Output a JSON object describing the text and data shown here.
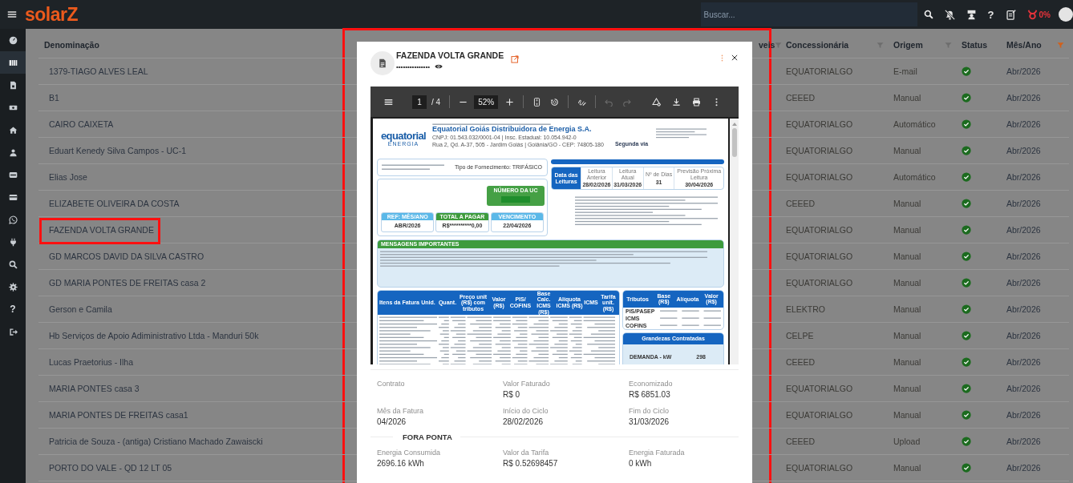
{
  "topbar": {
    "logo": "solarZ",
    "search": {
      "placeholder": "Buscar..."
    },
    "help": "?",
    "alert_level": "0%"
  },
  "sidebar": {
    "items": [
      {
        "selected": false
      },
      {
        "selected": true
      },
      {
        "selected": false
      },
      {
        "selected": false
      },
      {
        "selected": false
      },
      {
        "selected": false
      },
      {
        "selected": false
      },
      {
        "selected": false
      },
      {
        "selected": false
      },
      {
        "selected": false
      },
      {
        "selected": false
      },
      {
        "selected": false
      },
      {
        "selected": false,
        "glyph": "?"
      },
      {
        "selected": false
      }
    ]
  },
  "table": {
    "columns": [
      {
        "label": "Denominação",
        "filter": false
      },
      {
        "label": "veis",
        "filter": true,
        "filter_active": false
      },
      {
        "label": "Concessionária",
        "filter": true,
        "filter_active": false
      },
      {
        "label": "Origem",
        "filter": true,
        "filter_active": false
      },
      {
        "label": "Status",
        "filter": false
      },
      {
        "label": "Mês/Ano",
        "filter": true,
        "filter_active": true
      }
    ],
    "rows": [
      {
        "name": "1379-TIAGO ALVES LEAL",
        "utility": "EQUATORIALGO",
        "origin": "E-mail",
        "ok": true,
        "month": "Abr/2026",
        "marked": false
      },
      {
        "name": "B1",
        "utility": "CEEED",
        "origin": "Manual",
        "ok": true,
        "month": "Abr/2026",
        "marked": false
      },
      {
        "name": "CAIRO CAIXETA",
        "utility": "EQUATORIALGO",
        "origin": "Automático",
        "ok": true,
        "month": "Abr/2026",
        "marked": false
      },
      {
        "name": "Eduart Kenedy Silva Campos - UC-1",
        "utility": "EQUATORIALGO",
        "origin": "Manual",
        "ok": true,
        "month": "Abr/2026",
        "marked": false
      },
      {
        "name": "Elias Jose",
        "utility": "EQUATORIALGO",
        "origin": "Automático",
        "ok": true,
        "month": "Abr/2026",
        "marked": false
      },
      {
        "name": "ELIZABETE OLIVEIRA DA COSTA",
        "utility": "CEEED",
        "origin": "Manual",
        "ok": true,
        "month": "Abr/2026",
        "marked": false
      },
      {
        "name": "FAZENDA VOLTA GRANDE",
        "utility": "EQUATORIALGO",
        "origin": "Manual",
        "ok": true,
        "month": "Abr/2026",
        "marked": true
      },
      {
        "name": "GD MARCOS DAVID DA SILVA CASTRO",
        "utility": "EQUATORIALGO",
        "origin": "Manual",
        "ok": true,
        "month": "Abr/2026",
        "marked": false
      },
      {
        "name": "GD MARIA PONTES DE FREITAS casa 2",
        "utility": "EQUATORIALGO",
        "origin": "Manual",
        "ok": true,
        "month": "Abr/2026",
        "marked": false
      },
      {
        "name": "Gerson e Camila",
        "utility": "ELEKTRO",
        "origin": "Manual",
        "ok": true,
        "month": "Abr/2026",
        "marked": false
      },
      {
        "name": "Hb Serviços de Apoio Adiministrativo Ltda - Manduri 50k",
        "utility": "CELPE",
        "origin": "Manual",
        "ok": true,
        "month": "Abr/2026",
        "marked": false
      },
      {
        "name": "Lucas Praetorius - Ilha",
        "utility": "CEEED",
        "origin": "Manual",
        "ok": true,
        "month": "Abr/2026",
        "marked": false
      },
      {
        "name": "MARIA PONTES casa 3",
        "utility": "EQUATORIALGO",
        "origin": "Manual",
        "ok": true,
        "month": "Abr/2026",
        "marked": false
      },
      {
        "name": "MARIA PONTES DE FREITAS casa1",
        "utility": "EQUATORIALGO",
        "origin": "Manual",
        "ok": true,
        "month": "Abr/2026",
        "marked": false
      },
      {
        "name": "Patricia de Souza - (antiga) Cristiano Machado Zawaiscki",
        "utility": "CEEED",
        "origin": "Upload",
        "ok": true,
        "month": "Abr/2026",
        "marked": false
      },
      {
        "name": "PORTO DO VALE - QD 12 LT 05",
        "utility": "EQUATORIALGO",
        "origin": "Manual",
        "ok": true,
        "month": "Abr/2026",
        "marked": false
      }
    ]
  },
  "modal": {
    "title": "FAZENDA VOLTA GRANDE",
    "masked_id": "•••••••••••••••",
    "marked": true,
    "viewer": {
      "page": "1",
      "page_count": "/ 4",
      "zoom": "52%",
      "undo_enabled": false,
      "redo_enabled": false,
      "document": {
        "logo": "equatorial",
        "logo_sub": "ENERGIA",
        "company": "Equatorial Goiás Distribuidora de Energia S.A.",
        "cnpj": "CNPJ: 01.543.032/0001-04 | Insc. Estadual: 10.054.942-0",
        "address": "Rua 2, Qd. A-37, 505 - Jardim Goiás | Goiânia/GO - CEP: 74805-180",
        "copy_label": "Segunda via",
        "supply": "Tipo de Fornecimento: TRIFÁSICO",
        "uc_label": "NÚMERO DA UC",
        "summary": [
          {
            "label": "REF: MÊS/ANO",
            "value": "ABR/2026",
            "color": "#5bb8e8"
          },
          {
            "label": "TOTAL A PAGAR",
            "value": "R$**********0,00",
            "color": "#3d9b3d"
          },
          {
            "label": "VENCIMENTO",
            "value": "22/04/2026",
            "color": "#5bb8e8"
          }
        ],
        "readings_title": "Data das Leituras",
        "readings": [
          {
            "label": "Leitura Anterior",
            "value": "28/02/2026"
          },
          {
            "label": "Leitura Atual",
            "value": "31/03/2026"
          },
          {
            "label": "Nº de Dias",
            "value": "31"
          },
          {
            "label": "Previsão Próxima Leitura",
            "value": "30/04/2026"
          }
        ],
        "messages_title": "MENSAGENS IMPORTANTES",
        "items_columns": [
          "Itens da Fatura",
          "Unid.",
          "Quant.",
          "Preço unit (R$) com tributos",
          "Valor (R$)",
          "PIS/ COFINS",
          "Base Calc. ICMS (R$)",
          "Alíquota ICMS (R$)",
          "ICMS",
          "Tarifa unit. (R$)"
        ],
        "taxes_columns": [
          "Tributos",
          "Base (R$)",
          "Alíquota",
          "Valor (R$)"
        ],
        "taxes_rows": [
          "PIS/PASEP",
          "ICMS",
          "COFINS"
        ],
        "contracted_title": "Grandezas Contratadas",
        "contracted": [
          {
            "label": "DEMANDA - kW",
            "value": "298"
          }
        ]
      }
    },
    "details": [
      {
        "kind": "fields",
        "fields": [
          {
            "label": "Contrato"
          },
          {
            "label": "Valor Faturado",
            "value": "R$ 0"
          },
          {
            "label": "Economizado",
            "value": "R$ 6851.03"
          }
        ]
      },
      {
        "kind": "fields",
        "fields": [
          {
            "label": "Mês da Fatura",
            "value": "04/2026"
          },
          {
            "label": "Início do Ciclo",
            "value": "28/02/2026"
          },
          {
            "label": "Fim do Ciclo",
            "value": "31/03/2026"
          }
        ]
      },
      {
        "kind": "section",
        "title": "FORA PONTA"
      },
      {
        "kind": "fields",
        "fields": [
          {
            "label": "Energia Consumida",
            "value": "2696.16 kWh"
          },
          {
            "label": "Valor da Tarifa",
            "value": "R$ 0.52698457"
          },
          {
            "label": "Energia Faturada",
            "value": "0 kWh"
          }
        ]
      }
    ]
  }
}
